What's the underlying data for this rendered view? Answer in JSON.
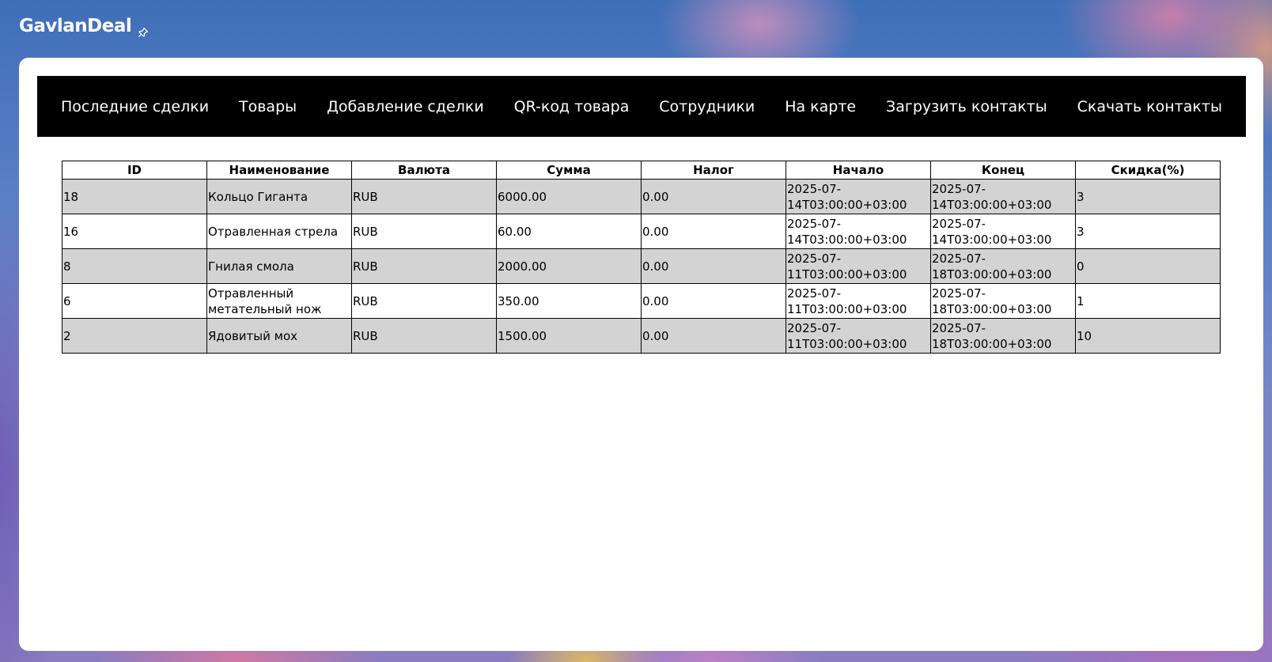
{
  "app": {
    "title": "GavlanDeal"
  },
  "nav": {
    "items": [
      {
        "label": "Последние сделки"
      },
      {
        "label": "Товары"
      },
      {
        "label": "Добавление сделки"
      },
      {
        "label": "QR-код товара"
      },
      {
        "label": "Сотрудники"
      },
      {
        "label": "На карте"
      },
      {
        "label": "Загрузить контакты"
      },
      {
        "label": "Скачать контакты"
      }
    ]
  },
  "table": {
    "headers": [
      "ID",
      "Наименование",
      "Валюта",
      "Сумма",
      "Налог",
      "Начало",
      "Конец",
      "Скидка(%)"
    ],
    "rows": [
      [
        "18",
        "Кольцо Гиганта",
        "RUB",
        "6000.00",
        "0.00",
        "2025-07-14T03:00:00+03:00",
        "2025-07-14T03:00:00+03:00",
        "3"
      ],
      [
        "16",
        "Отравленная стрела",
        "RUB",
        "60.00",
        "0.00",
        "2025-07-14T03:00:00+03:00",
        "2025-07-14T03:00:00+03:00",
        "3"
      ],
      [
        "8",
        "Гнилая смола",
        "RUB",
        "2000.00",
        "0.00",
        "2025-07-11T03:00:00+03:00",
        "2025-07-18T03:00:00+03:00",
        "0"
      ],
      [
        "6",
        "Отравленный метательный нож",
        "RUB",
        "350.00",
        "0.00",
        "2025-07-11T03:00:00+03:00",
        "2025-07-18T03:00:00+03:00",
        "1"
      ],
      [
        "2",
        "Ядовитый мох",
        "RUB",
        "1500.00",
        "0.00",
        "2025-07-11T03:00:00+03:00",
        "2025-07-18T03:00:00+03:00",
        "10"
      ]
    ]
  },
  "colors": {
    "navbar_bg": "#000000",
    "row_stripe": "#d3d3d3",
    "card_bg": "#ffffff"
  },
  "icons": {
    "pin": "pin-icon"
  }
}
